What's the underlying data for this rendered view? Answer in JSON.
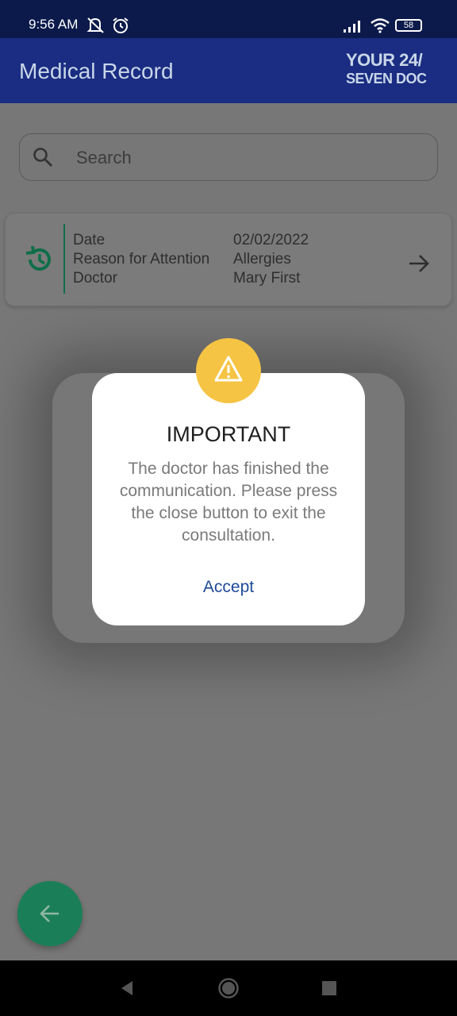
{
  "status_bar": {
    "time": "9:56 AM",
    "battery": "58",
    "icons": [
      "mute-icon",
      "alarm-icon",
      "signal-icon",
      "wifi-icon",
      "battery-icon"
    ]
  },
  "app_bar": {
    "title": "Medical Record",
    "logo": {
      "line1": "YOUR 24/",
      "line2": "SEVEN DOC"
    }
  },
  "search": {
    "placeholder": "Search"
  },
  "record": {
    "labels": {
      "date": "Date",
      "reason": "Reason for Attention",
      "doctor": "Doctor"
    },
    "values": {
      "date": "02/02/2022",
      "reason": "Allergies",
      "doctor": "Mary First"
    }
  },
  "dialog": {
    "title": "IMPORTANT",
    "message": "The doctor has finished the communication. Please press the close button to exit the consultation.",
    "accept_label": "Accept"
  },
  "colors": {
    "status_bar": "#0c1a4b",
    "app_bar": "#1a2d82",
    "accent_green": "#1a7f58",
    "warning_yellow": "#f6c444",
    "link_blue": "#1f4a9a"
  }
}
